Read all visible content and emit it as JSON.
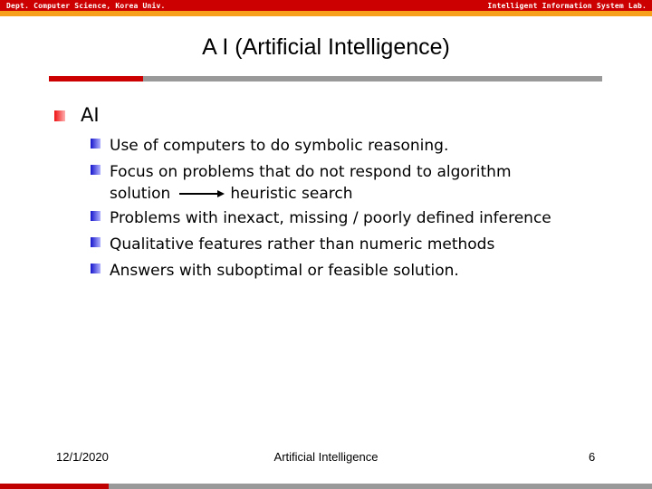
{
  "header": {
    "left_text": "Dept. Computer Science, Korea Univ.",
    "right_text": "Intelligent Information System Lab."
  },
  "slide": {
    "title": "A I (Artificial Intelligence)",
    "level1": {
      "label": "AI",
      "items": [
        {
          "text": "Use of computers to do symbolic reasoning."
        },
        {
          "text": "Focus on problems that do not respond to algorithm",
          "line2_before_arrow": "solution",
          "line2_after_arrow": "heuristic search"
        },
        {
          "text": "Problems with inexact, missing / poorly defined inference"
        },
        {
          "text": "Qualitative features rather than numeric methods"
        },
        {
          "text": "Answers with suboptimal or feasible solution."
        }
      ]
    }
  },
  "footer": {
    "date": "12/1/2020",
    "title": "Artificial Intelligence",
    "page": "6"
  },
  "colors": {
    "header_red": "#cc0000",
    "header_orange": "#f7a01c",
    "rule_gray": "#999999",
    "bullet_l1": "#ee1111",
    "bullet_l2": "#1515cc"
  }
}
